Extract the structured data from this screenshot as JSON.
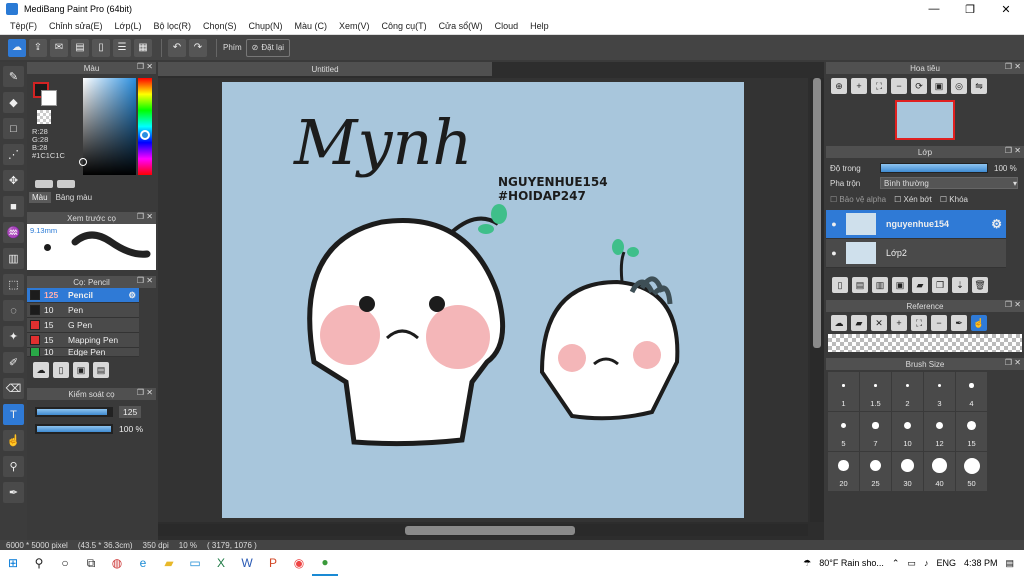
{
  "window": {
    "title": "MediBang Paint Pro (64bit)",
    "minimize": "—",
    "maximize": "❐",
    "close": "✕"
  },
  "menu": [
    "Tệp(F)",
    "Chỉnh sửa(E)",
    "Lớp(L)",
    "Bộ lọc(R)",
    "Chọn(S)",
    "Chụp(N)",
    "Màu (C)",
    "Xem(V)",
    "Công cụ(T)",
    "Cửa sổ(W)",
    "Cloud",
    "Help"
  ],
  "toolbar": {
    "keys_label": "Phím",
    "reset_label": "Đặt lại"
  },
  "color_panel": {
    "title": "Màu",
    "r": "R:28",
    "g": "G:28",
    "b": "B:28",
    "hex": "#1C1C1C",
    "tab_color": "Màu",
    "tab_palette": "Bảng màu",
    "primary": "#1c1c1c",
    "secondary": "#ffffff",
    "accent": "#d22323"
  },
  "preview_panel": {
    "title": "Xem trước cọ",
    "size": "9.13mm"
  },
  "brush_panel": {
    "title": "Cọ: Pencil",
    "items": [
      {
        "size": "125",
        "name": "Pencil",
        "color": "#1c1c1c"
      },
      {
        "size": "10",
        "name": "Pen",
        "color": "#1c1c1c"
      },
      {
        "size": "15",
        "name": "G Pen",
        "color": "#e03030"
      },
      {
        "size": "15",
        "name": "Mapping Pen",
        "color": "#e03030"
      },
      {
        "size": "10",
        "name": "Edge Pen",
        "color": "#29a847"
      }
    ]
  },
  "control_panel": {
    "title": "Kiểm soát cọ",
    "size_value": "125",
    "opacity_value": "100 %",
    "size_level": 0.95,
    "opacity_level": 1.0
  },
  "document": {
    "tab": "Untitled",
    "canvas_bg": "#a8c6dc",
    "title_text": "Mynh",
    "caption_line1": "NGUYENHUE154",
    "caption_line2": "#HOIDAP247"
  },
  "navigator": {
    "title": "Hoa tiêu"
  },
  "layer_panel": {
    "title": "Lớp",
    "opacity_label": "Độ trong",
    "opacity_value": "100 %",
    "blend_label": "Pha trộn",
    "blend_value": "Bình thường",
    "protect_alpha": "Bảo vệ alpha",
    "clip": "Xén bớt",
    "lock": "Khóa",
    "layers": [
      {
        "name": "nguyenhue154"
      },
      {
        "name": "Lớp2"
      }
    ]
  },
  "reference_panel": {
    "title": "Reference"
  },
  "brush_size_panel": {
    "title": "Brush Size",
    "sizes": [
      "1",
      "1.5",
      "2",
      "3",
      "4",
      "5",
      "7",
      "10",
      "12",
      "15",
      "20",
      "25",
      "30",
      "40",
      "50"
    ]
  },
  "status": {
    "dimensions": "6000 * 5000 pixel",
    "physical": "(43.5 * 36.3cm)",
    "dpi": "350 dpi",
    "zoom": "10 %",
    "coords": "( 3179, 1076 )"
  },
  "taskbar": {
    "weather": "80°F  Rain sho...",
    "lang": "ENG",
    "time": "4:38 PM"
  }
}
